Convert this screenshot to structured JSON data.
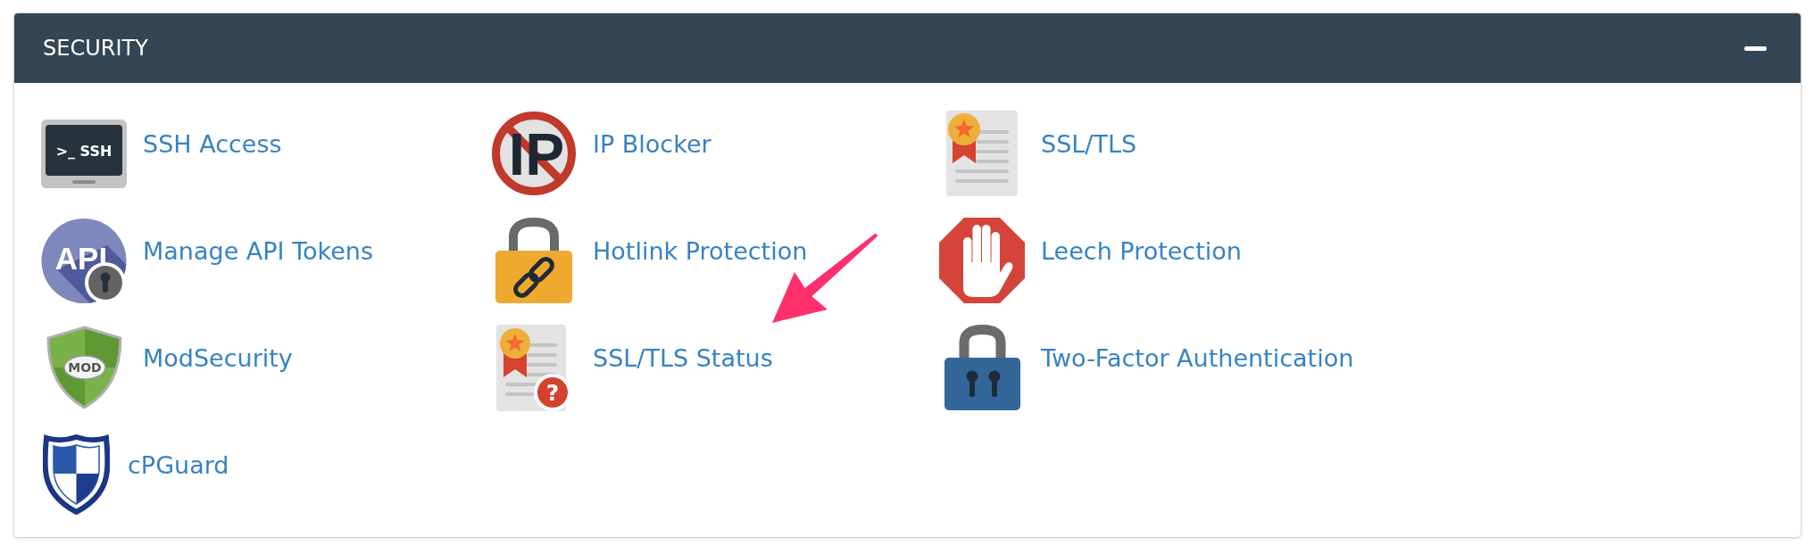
{
  "panel": {
    "title": "SECURITY",
    "expanded": true
  },
  "items": [
    {
      "label": "SSH Access",
      "icon_text": ">_ SSH",
      "arrow_marked": false
    },
    {
      "label": "IP Blocker",
      "icon_text": "IP",
      "arrow_marked": false
    },
    {
      "label": "SSL/TLS",
      "arrow_marked": false
    },
    {
      "label": "Manage API Tokens",
      "icon_text": "API",
      "arrow_marked": false
    },
    {
      "label": "Hotlink Protection",
      "arrow_marked": false
    },
    {
      "label": "Leech Protection",
      "arrow_marked": false
    },
    {
      "label": "ModSecurity",
      "icon_text": "MOD",
      "arrow_marked": false
    },
    {
      "label": "SSL/TLS Status",
      "icon_text": "?",
      "arrow_marked": true
    },
    {
      "label": "Two-Factor Authentication",
      "arrow_marked": false
    },
    {
      "label": "cPGuard",
      "arrow_marked": false
    }
  ]
}
